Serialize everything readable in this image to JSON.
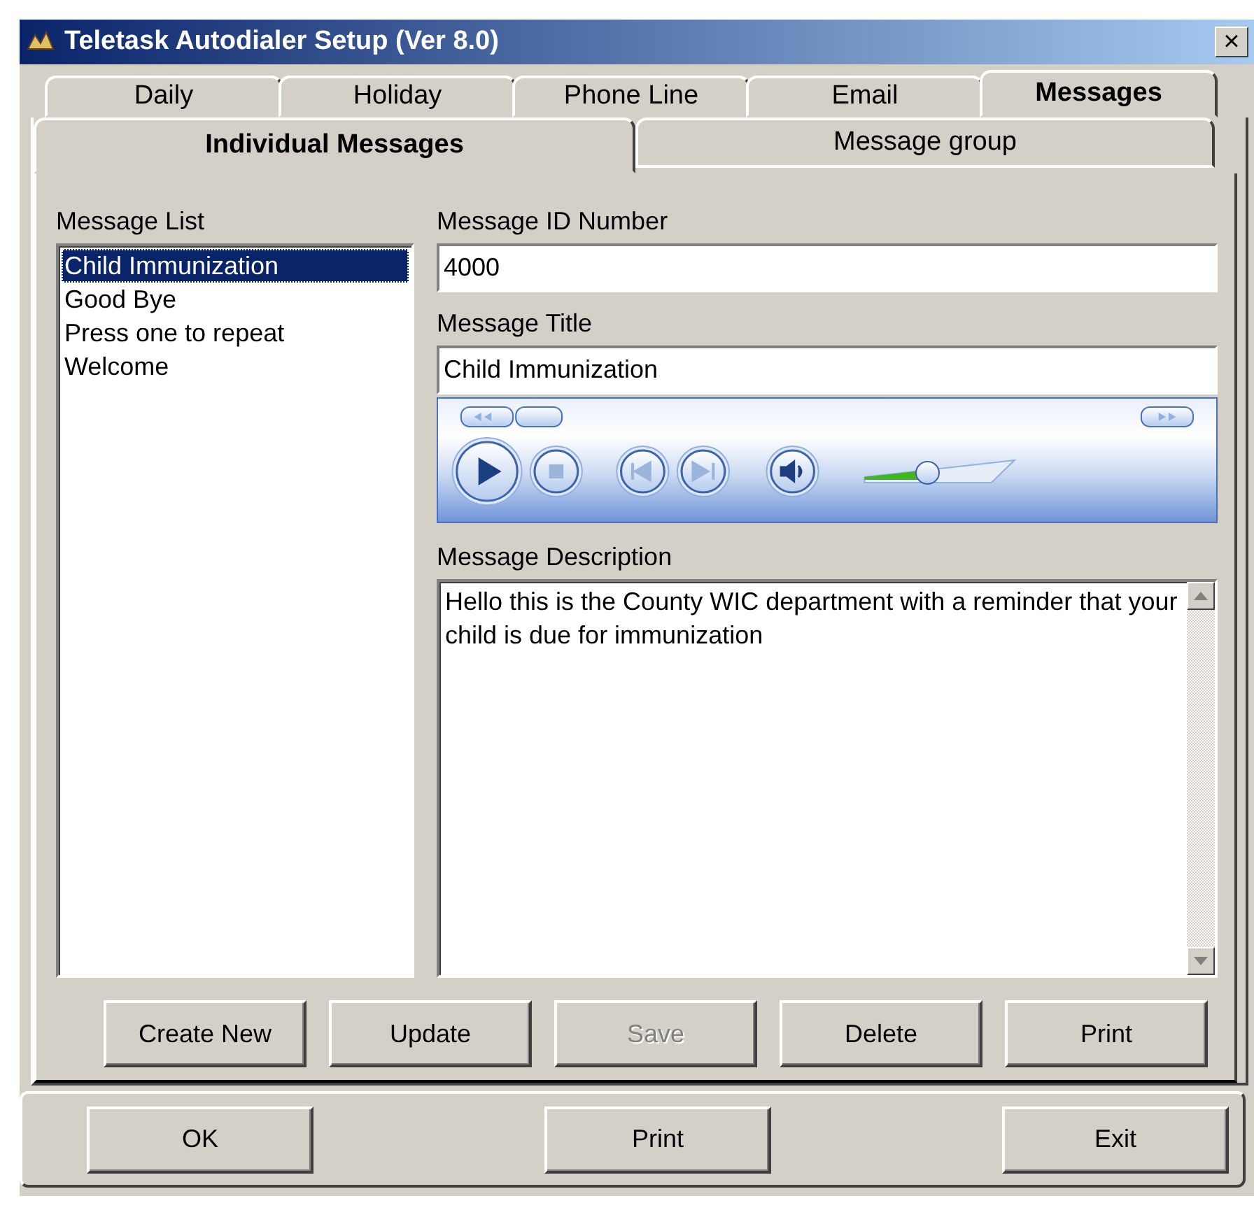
{
  "window": {
    "title": "Teletask Autodialer Setup (Ver 8.0)",
    "close": "×"
  },
  "tabs": [
    {
      "label": "Daily",
      "selected": false
    },
    {
      "label": "Holiday",
      "selected": false
    },
    {
      "label": "Phone Line",
      "selected": false
    },
    {
      "label": "Email",
      "selected": false
    },
    {
      "label": "Messages",
      "selected": true
    }
  ],
  "subtabs": [
    {
      "label": "Individual Messages",
      "selected": true
    },
    {
      "label": "Message group",
      "selected": false
    }
  ],
  "message_list": {
    "label": "Message List",
    "items": [
      {
        "label": "Child Immunization",
        "selected": true
      },
      {
        "label": "Good Bye",
        "selected": false
      },
      {
        "label": "Press one to repeat",
        "selected": false
      },
      {
        "label": "Welcome",
        "selected": false
      }
    ]
  },
  "message_id": {
    "label": "Message ID Number",
    "value": "4000"
  },
  "message_title": {
    "label": "Message Title",
    "value": "Child Immunization"
  },
  "player": {
    "volume": {
      "level": 0.42
    }
  },
  "message_description": {
    "label": "Message Description",
    "value": "Hello this is the County WIC department with a reminder that your child is due for immunization"
  },
  "buttons": [
    {
      "label": "Create New",
      "disabled": false
    },
    {
      "label": "Update",
      "disabled": false
    },
    {
      "label": "Save",
      "disabled": true
    },
    {
      "label": "Delete",
      "disabled": false
    },
    {
      "label": "Print",
      "disabled": false
    }
  ],
  "footer_buttons": [
    {
      "label": "OK"
    },
    {
      "label": "Print"
    },
    {
      "label": "Exit"
    }
  ]
}
